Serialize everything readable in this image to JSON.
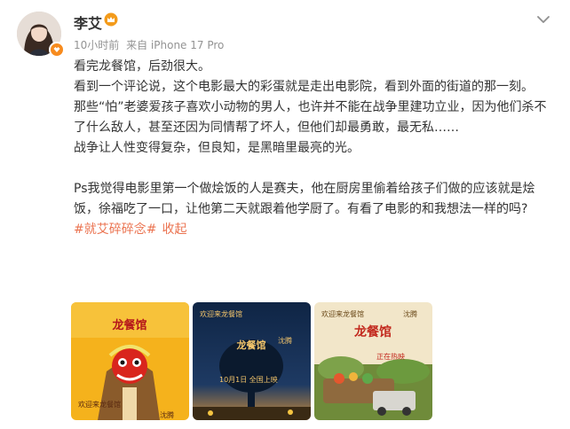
{
  "post": {
    "author": "李艾",
    "time": "10小时前",
    "source": "来自 iPhone 17 Pro",
    "paragraphs": [
      "看完龙餐馆，后劲很大。",
      "看到一个评论说，这个电影最大的彩蛋就是走出电影院，看到外面的街道的那一刻。",
      "那些“怕”老婆爱孩子喜欢小动物的男人，也许并不能在战争里建功立业，因为他们杀不了什么敌人，甚至还因为同情帮了坏人，但他们却最勇敢，最无私……",
      "战争让人性变得复杂，但良知，是黑暗里最亮的光。"
    ],
    "ps": "Ps我觉得电影里第一个做烩饭的人是赛夫，他在厨房里偷着给孩子们做的应该就是烩饭，徐福吃了一口，让他第二天就跟着他学厨了。有看了电影的和我想法一样的吗?",
    "topic": "#就艾碎碎念#",
    "collapse": "收起"
  },
  "posters": [
    {
      "title": "欢迎来龙餐馆",
      "cast": "沈腾",
      "colors": {
        "bg": "#f5b21c",
        "accent": "#b5171b"
      }
    },
    {
      "title": "欢迎来龙餐馆",
      "cast": "沈腾",
      "date": "10月1日 全国上映",
      "colors": {
        "bg": "#1e3a63",
        "accent": "#f2c46b"
      }
    },
    {
      "title": "欢迎来龙餐馆",
      "cast": "沈腾",
      "date": "正在热映",
      "colors": {
        "bg": "#f2e6c9",
        "accent": "#c2281d"
      }
    }
  ],
  "icons": {
    "more": "chevron-down-icon",
    "verified": "verified-badge-icon",
    "vip": "crown-icon"
  },
  "colors": {
    "link": "#eb7350",
    "meta": "#939393",
    "text": "#333333",
    "verified": "#f78b1e"
  }
}
